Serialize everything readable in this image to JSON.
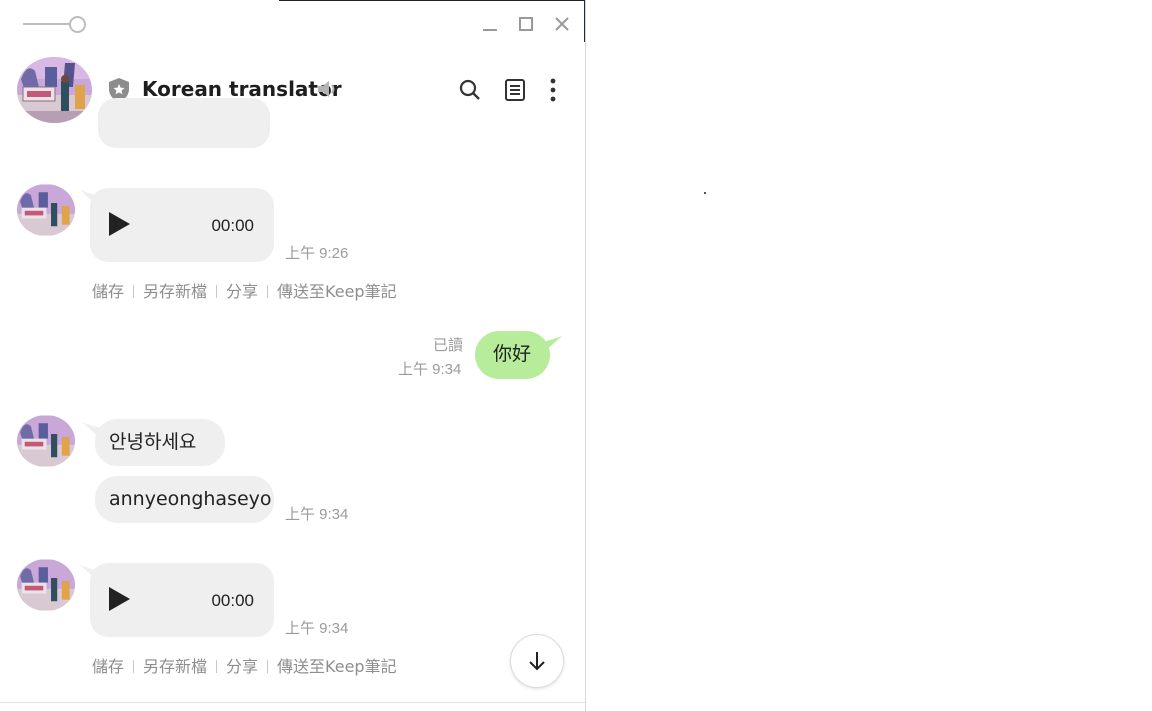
{
  "window": {
    "title": "Korean translator",
    "controls": {
      "minimize_icon": "minimize-icon",
      "maximize_icon": "maximize-icon",
      "close_icon": "close-icon"
    }
  },
  "header": {
    "shield_icon": "shield-star-icon",
    "title": "Korean translator",
    "mute_icon": "speaker-icon",
    "actions": [
      "search-icon",
      "notes-icon",
      "more-vertical-icon"
    ]
  },
  "messages": {
    "voice1": {
      "duration": "00:00",
      "time": "上午 9:26",
      "actions": [
        "儲存",
        "另存新檔",
        "分享",
        "傳送至Keep筆記"
      ]
    },
    "sent1": {
      "read": "已讀",
      "time": "上午 9:34",
      "text": "你好"
    },
    "reply1": {
      "text": "안녕하세요",
      "romanized": "annyeonghaseyo",
      "time": "上午 9:34"
    },
    "voice2": {
      "duration": "00:00",
      "time": "上午 9:34",
      "actions": [
        "儲存",
        "另存新檔",
        "分享",
        "傳送至Keep筆記"
      ]
    }
  },
  "colors": {
    "sent_bubble": "#b6ec9a",
    "received_bubble": "#efefef",
    "time_text": "#9b9b9b"
  },
  "scroll_button_icon": "arrow-down-icon"
}
